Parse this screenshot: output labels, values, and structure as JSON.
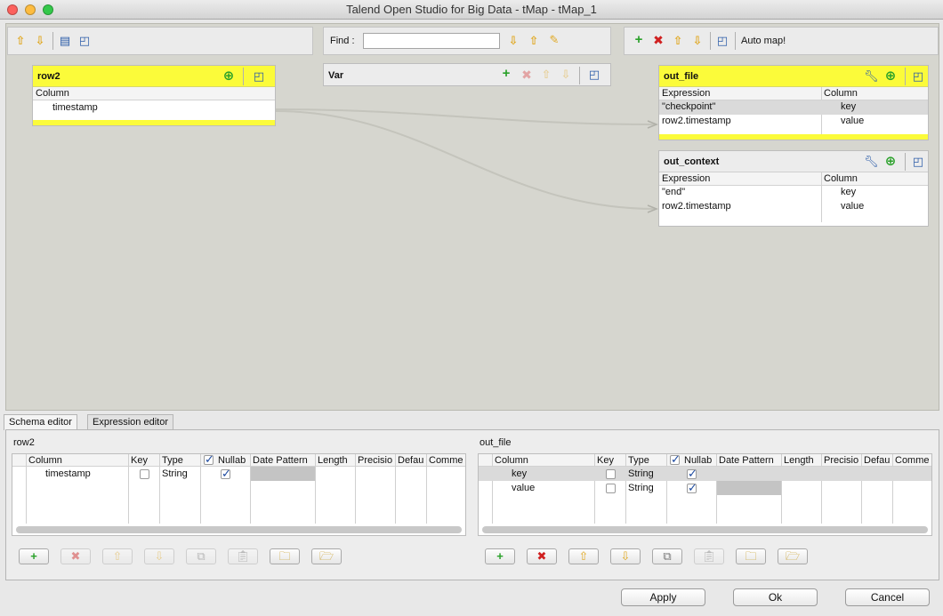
{
  "window": {
    "title": "Talend Open Studio for Big Data - tMap - tMap_1"
  },
  "find": {
    "label": "Find :",
    "value": ""
  },
  "output_toolbar": {
    "automap_label": "Auto map!"
  },
  "var_table": {
    "title": "Var"
  },
  "input_table": {
    "title": "row2",
    "column_header": "Column",
    "rows": [
      "timestamp"
    ]
  },
  "out_file": {
    "title": "out_file",
    "headers": {
      "expression": "Expression",
      "column": "Column"
    },
    "rows": [
      {
        "expression": "\"checkpoint\"",
        "column": "key"
      },
      {
        "expression": "row2.timestamp",
        "column": "value"
      }
    ]
  },
  "out_context": {
    "title": "out_context",
    "headers": {
      "expression": "Expression",
      "column": "Column"
    },
    "rows": [
      {
        "expression": "\"end\"",
        "column": "key"
      },
      {
        "expression": "row2.timestamp",
        "column": "value"
      }
    ]
  },
  "tabs": [
    {
      "label": "Schema editor"
    },
    {
      "label": "Expression editor"
    }
  ],
  "schema_left": {
    "title": "row2",
    "headers": [
      "Column",
      "Key",
      "Type",
      "Nullab",
      "Date Pattern",
      "Length",
      "Precisio",
      "Defau",
      "Comme"
    ],
    "rows": [
      {
        "column": "timestamp",
        "key": false,
        "type": "String",
        "nullable": true
      }
    ]
  },
  "schema_right": {
    "title": "out_file",
    "headers": [
      "Column",
      "Key",
      "Type",
      "Nullab",
      "Date Pattern",
      "Length",
      "Precisio",
      "Defau",
      "Comme"
    ],
    "rows": [
      {
        "column": "key",
        "key": false,
        "type": "String",
        "nullable": true
      },
      {
        "column": "value",
        "key": false,
        "type": "String",
        "nullable": true
      }
    ]
  },
  "footer": {
    "apply": "Apply",
    "ok": "Ok",
    "cancel": "Cancel"
  },
  "colors": {
    "table_header": "#fbfb3a",
    "canvas": "#d6d6cf",
    "link": "#c0c0b8"
  }
}
